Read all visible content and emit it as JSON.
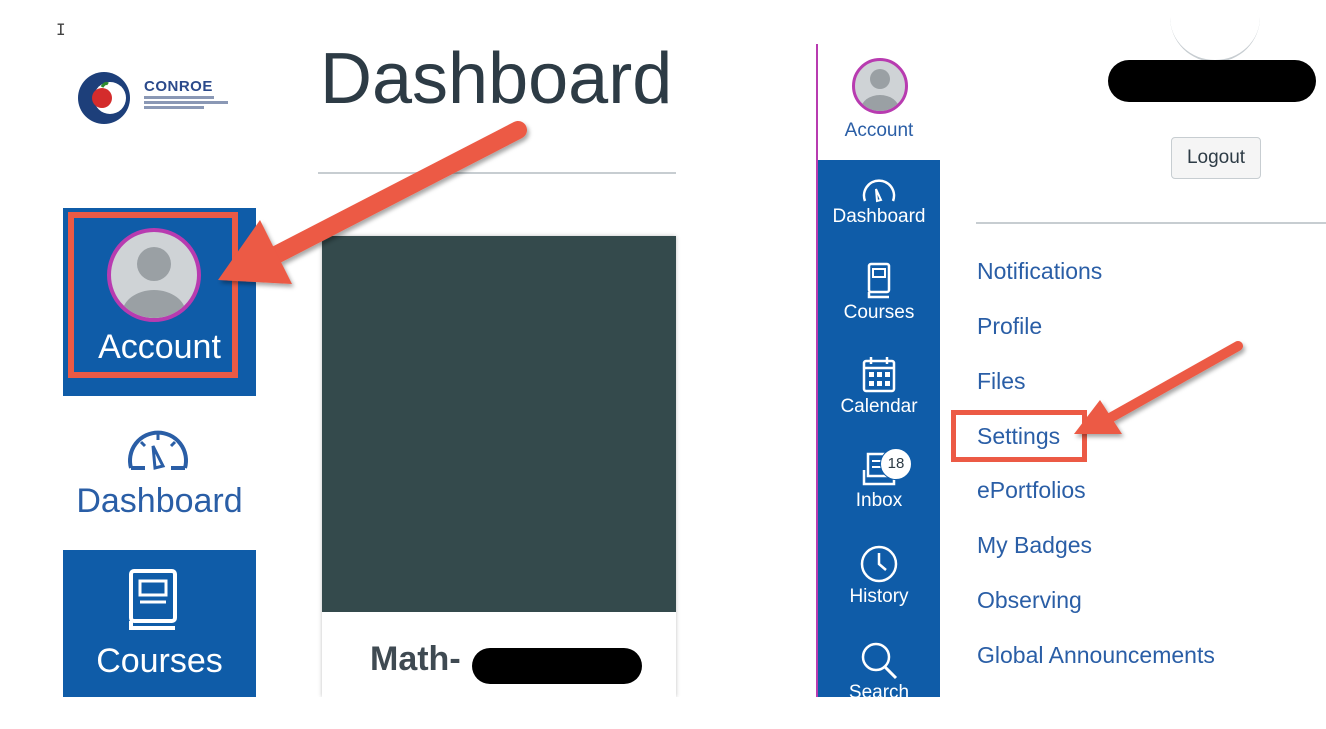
{
  "cursor_glyph": "I",
  "left": {
    "logo": {
      "name": "CONROE",
      "subtitle_icon": "conroe-isd-logo"
    },
    "nav": {
      "account_label": "Account",
      "dashboard_label": "Dashboard",
      "courses_label": "Courses"
    },
    "page_title": "Dashboard",
    "course_card": {
      "name_visible": "Math-"
    }
  },
  "right": {
    "nav": {
      "account_label": "Account",
      "items": [
        {
          "label": "Dashboard",
          "icon": "dashboard-icon"
        },
        {
          "label": "Courses",
          "icon": "courses-icon"
        },
        {
          "label": "Calendar",
          "icon": "calendar-icon"
        },
        {
          "label": "Inbox",
          "icon": "inbox-icon",
          "badge": "18"
        },
        {
          "label": "History",
          "icon": "history-icon"
        },
        {
          "label": "Search",
          "icon": "search-icon"
        }
      ]
    },
    "logout_label": "Logout",
    "account_menu": [
      "Notifications",
      "Profile",
      "Files",
      "Settings",
      "ePortfolios",
      "My Badges",
      "Observing",
      "Global Announcements"
    ]
  },
  "colors": {
    "nav_blue": "#0f5ca8",
    "link_blue": "#2a5ea6",
    "highlight_red": "#ec5a45",
    "avatar_ring": "#b83bb0",
    "card_image": "#344a4c"
  }
}
